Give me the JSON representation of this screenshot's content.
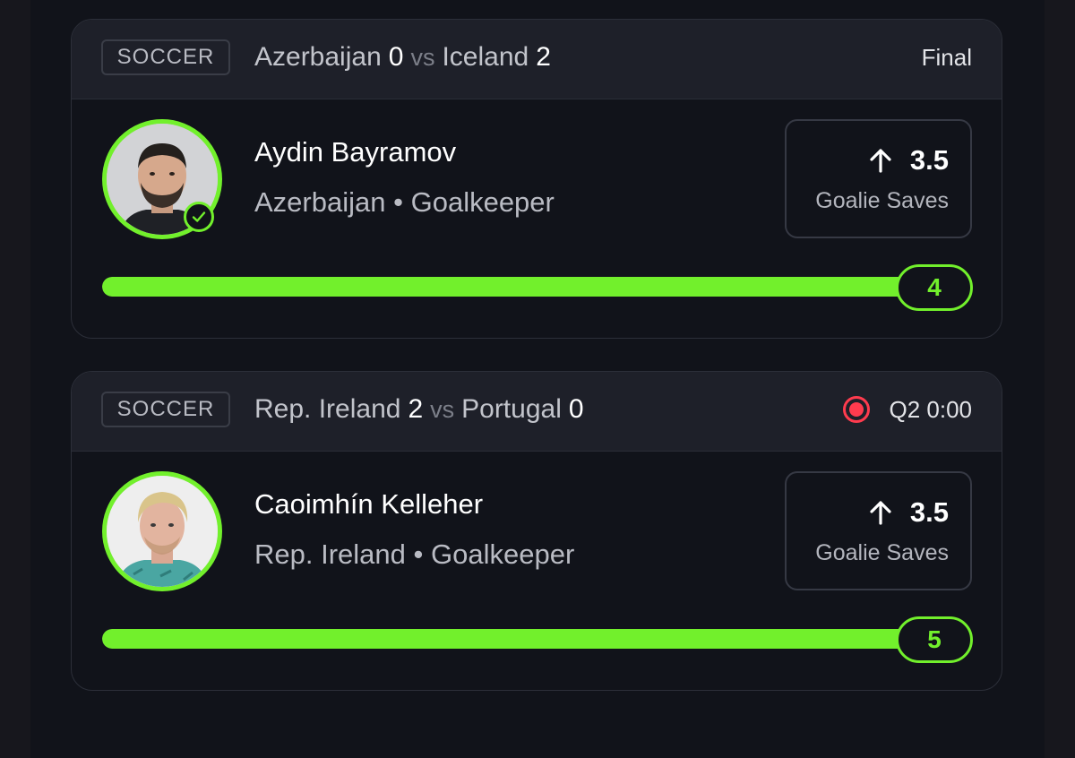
{
  "accent_color": "#72f02c",
  "live_color": "#ff3b4e",
  "cards": [
    {
      "sport": "SOCCER",
      "home_team": "Azerbaijan",
      "home_score": "0",
      "vs": "vs",
      "away_team": "Iceland",
      "away_score": "2",
      "status": "Final",
      "status_live": false,
      "player_name": "Aydin Bayramov",
      "player_team": "Azerbaijan",
      "separator": "•",
      "player_position": "Goalkeeper",
      "verified": true,
      "pick_direction": "over",
      "pick_icon": "arrow-up-icon",
      "line": "3.5",
      "stat_type": "Goalie Saves",
      "progress": 1.0,
      "result": "4"
    },
    {
      "sport": "SOCCER",
      "home_team": "Rep. Ireland",
      "home_score": "2",
      "vs": "vs",
      "away_team": "Portugal",
      "away_score": "0",
      "status": "Q2 0:00",
      "status_live": true,
      "status_icon": "live-record-icon",
      "player_name": "Caoimhín Kelleher",
      "player_team": "Rep. Ireland",
      "separator": "•",
      "player_position": "Goalkeeper",
      "verified": false,
      "pick_direction": "over",
      "pick_icon": "arrow-up-icon",
      "line": "3.5",
      "stat_type": "Goalie Saves",
      "progress": 1.0,
      "result": "5"
    }
  ]
}
